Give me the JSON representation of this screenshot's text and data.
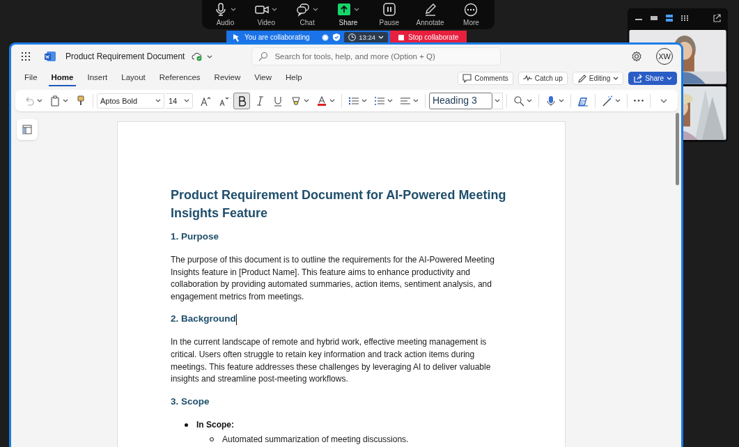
{
  "meeting_toolbar": {
    "buttons": [
      {
        "label": "Audio",
        "kind": "audio",
        "menu": true,
        "active": false
      },
      {
        "label": "Video",
        "kind": "video",
        "menu": true,
        "active": false
      },
      {
        "label": "Chat",
        "kind": "chat",
        "menu": true,
        "active": false
      },
      {
        "label": "Share",
        "kind": "share",
        "menu": true,
        "active": true
      },
      {
        "label": "Pause",
        "kind": "pause",
        "menu": false,
        "active": false
      },
      {
        "label": "Annotate",
        "kind": "annotate",
        "menu": false,
        "active": false
      },
      {
        "label": "More",
        "kind": "more",
        "menu": false,
        "active": false
      }
    ]
  },
  "collab_bar": {
    "status": "You are collaborating",
    "timer": "13:24",
    "stop_button": "Stop collaborate"
  },
  "word": {
    "title": "Product Requirement Document",
    "search_placeholder": "Search for tools, help, and more (Option + Q)",
    "avatar": "XW",
    "tabs": [
      {
        "label": "File",
        "selected": false
      },
      {
        "label": "Home",
        "selected": true
      },
      {
        "label": "Insert",
        "selected": false
      },
      {
        "label": "Layout",
        "selected": false
      },
      {
        "label": "References",
        "selected": false
      },
      {
        "label": "Review",
        "selected": false
      },
      {
        "label": "View",
        "selected": false
      },
      {
        "label": "Help",
        "selected": false
      }
    ],
    "actions": [
      {
        "label": "Comments",
        "kind": "comments"
      },
      {
        "label": "Catch up",
        "kind": "catchup"
      },
      {
        "label": "Editing",
        "kind": "editing"
      },
      {
        "label": "Share",
        "kind": "share"
      }
    ],
    "ribbon": {
      "font": "Aptos Bold",
      "size": "14",
      "bold_pressed": true,
      "style": "Heading 3"
    },
    "document": [
      {
        "kind": "title",
        "text": "Product Requirement Document for AI-Powered Meeting Insights Feature"
      },
      {
        "kind": "heading",
        "text": "1. Purpose",
        "cursor": false
      },
      {
        "kind": "paragraph",
        "text": "The purpose of this document is to outline the requirements for the AI-Powered Meeting Insights feature in [Product Name]. This feature aims to enhance productivity and collaboration by providing automated summaries, action items, sentiment analysis, and engagement metrics from meetings."
      },
      {
        "kind": "heading",
        "text": "2. Background",
        "cursor": true
      },
      {
        "kind": "paragraph",
        "text": "In the current landscape of remote and hybrid work, effective meeting management is critical. Users often struggle to retain key information and track action items during meetings. This feature addresses these challenges by leveraging AI to deliver valuable insights and streamline post-meeting workflows."
      },
      {
        "kind": "heading",
        "text": "3. Scope",
        "cursor": false
      },
      {
        "kind": "bullet",
        "text": "In Scope:",
        "children": [
          {
            "text": "Automated summarization of meeting discussions."
          }
        ]
      }
    ]
  }
}
